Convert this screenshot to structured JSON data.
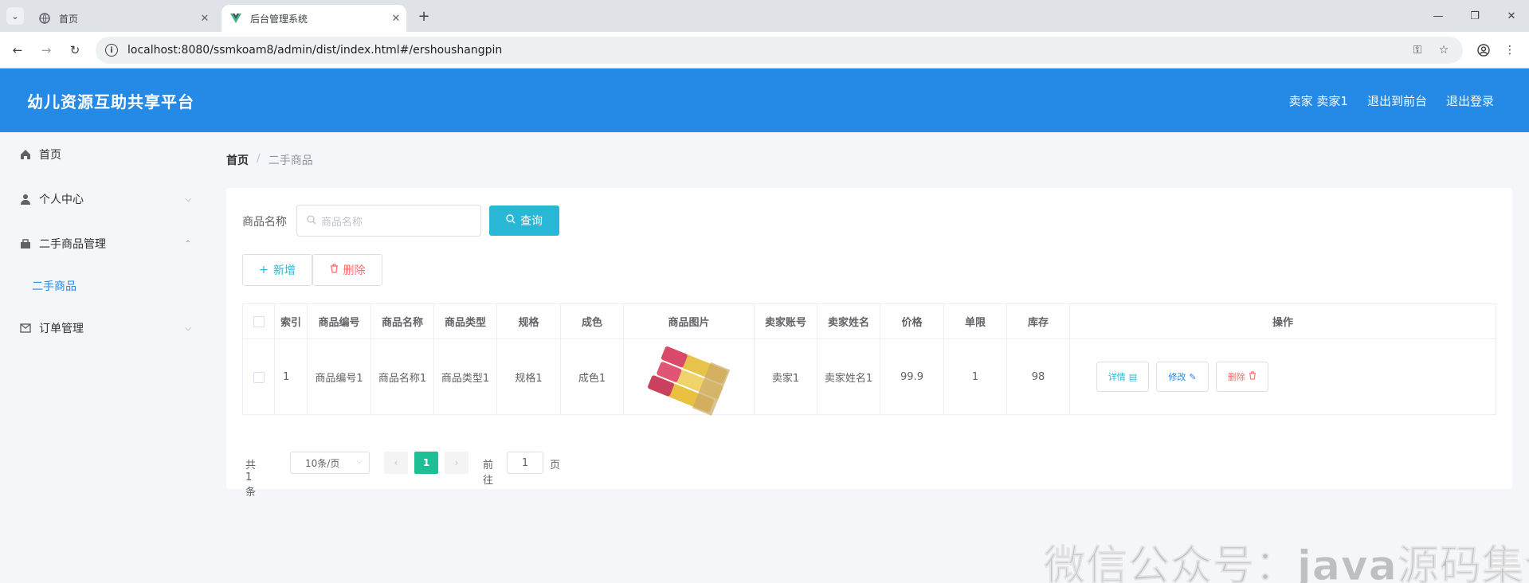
{
  "browser": {
    "tabs": [
      {
        "title": "首页",
        "active": false
      },
      {
        "title": "后台管理系统",
        "active": true
      }
    ],
    "url": "localhost:8080/ssmkoam8/admin/dist/index.html#/ershoushangpin"
  },
  "header": {
    "title": "幼儿资源互助共享平台",
    "user": "卖家 卖家1",
    "to_front": "退出到前台",
    "logout": "退出登录"
  },
  "sidebar": {
    "items": [
      {
        "label": "首页",
        "icon": "home-icon"
      },
      {
        "label": "个人中心",
        "icon": "user-icon"
      },
      {
        "label": "二手商品管理",
        "icon": "goods-icon"
      },
      {
        "label": "二手商品",
        "icon": ""
      },
      {
        "label": "订单管理",
        "icon": "mail-icon"
      }
    ]
  },
  "breadcrumb": {
    "home": "首页",
    "sep": "/",
    "current": "二手商品"
  },
  "search": {
    "label": "商品名称",
    "placeholder": "商品名称",
    "button": "查询"
  },
  "actions": {
    "add": "新增",
    "delete": "删除"
  },
  "table": {
    "headers": [
      "索引",
      "商品编号",
      "商品名称",
      "商品类型",
      "规格",
      "成色",
      "商品图片",
      "卖家账号",
      "卖家姓名",
      "价格",
      "单限",
      "库存",
      "操作"
    ],
    "rows": [
      {
        "index": "1",
        "code": "商品编号1",
        "name": "商品名称1",
        "type": "商品类型1",
        "spec": "规格1",
        "condition": "成色1",
        "seller_account": "卖家1",
        "seller_name": "卖家姓名1",
        "price": "99.9",
        "limit": "1",
        "stock": "98"
      }
    ],
    "op_labels": {
      "detail": "详情",
      "edit": "修改",
      "delete": "删除"
    }
  },
  "pagination": {
    "total": "共 1 条",
    "page_size": "10条/页",
    "current": "1",
    "goto": "前往",
    "goto_value": "1",
    "unit": "页"
  },
  "watermark": "微信公众号：java源码集合",
  "colors": {
    "primary": "#2589e6",
    "accent": "#28b8d6",
    "danger": "#f56c6c",
    "page_active": "#1fbf95"
  }
}
